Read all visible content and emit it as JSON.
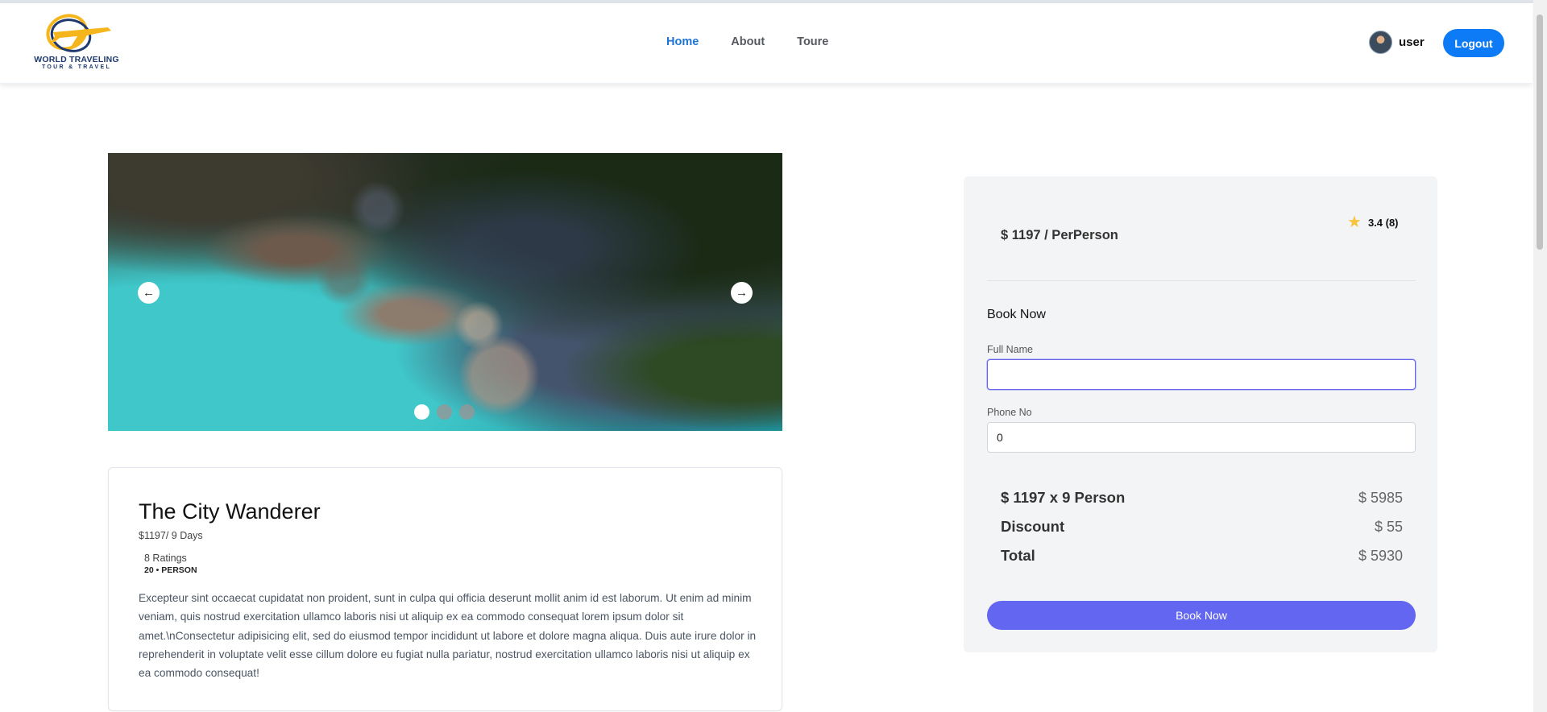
{
  "brand": {
    "name_line1": "WORLD TRAVELING",
    "name_line2": "TOUR & TRAVEL",
    "colors": {
      "ring": "#f5b51c",
      "navy": "#1f3a6e"
    }
  },
  "nav": {
    "items": [
      {
        "label": "Home",
        "active": true
      },
      {
        "label": "About",
        "active": false
      },
      {
        "label": "Toure",
        "active": false
      }
    ]
  },
  "user": {
    "name": "user",
    "logout_label": "Logout"
  },
  "carousel": {
    "prev_icon": "arrow-left-icon",
    "next_icon": "arrow-right-icon",
    "prev_glyph": "←",
    "next_glyph": "→",
    "slide_count": 3,
    "active_slide": 1
  },
  "tour": {
    "title": "The City Wanderer",
    "price_duration": "$1197/ 9 Days",
    "ratings": "8 Ratings",
    "persons": "20 • PERSON",
    "description": "Excepteur sint occaecat cupidatat non proident, sunt in culpa qui officia deserunt mollit anim id est laborum. Ut enim ad minim veniam, quis nostrud exercitation ullamco laboris nisi ut aliquip ex ea commodo consequat lorem ipsum dolor sit amet.\\nConsectetur adipisicing elit, sed do eiusmod tempor incididunt ut labore et dolore magna aliqua. Duis aute irure dolor in reprehenderit in voluptate velit esse cillum dolore eu fugiat nulla pariatur, nostrud exercitation ullamco laboris nisi ut aliquip ex ea commodo consequat!"
  },
  "booking": {
    "per_person": "$ 1197 / PerPerson",
    "rating": "3.4 (8)",
    "star_glyph": "★",
    "heading": "Book Now",
    "full_name_label": "Full Name",
    "full_name_value": "",
    "phone_label": "Phone No",
    "phone_value": "0",
    "subtotal_label": "$ 1197 x 9 Person",
    "subtotal_value": "$ 5985",
    "discount_label": "Discount",
    "discount_value": "$ 55",
    "total_label": "Total",
    "total_value": "$ 5930",
    "submit_label": "Book Now",
    "accent_color": "#6366f1"
  }
}
